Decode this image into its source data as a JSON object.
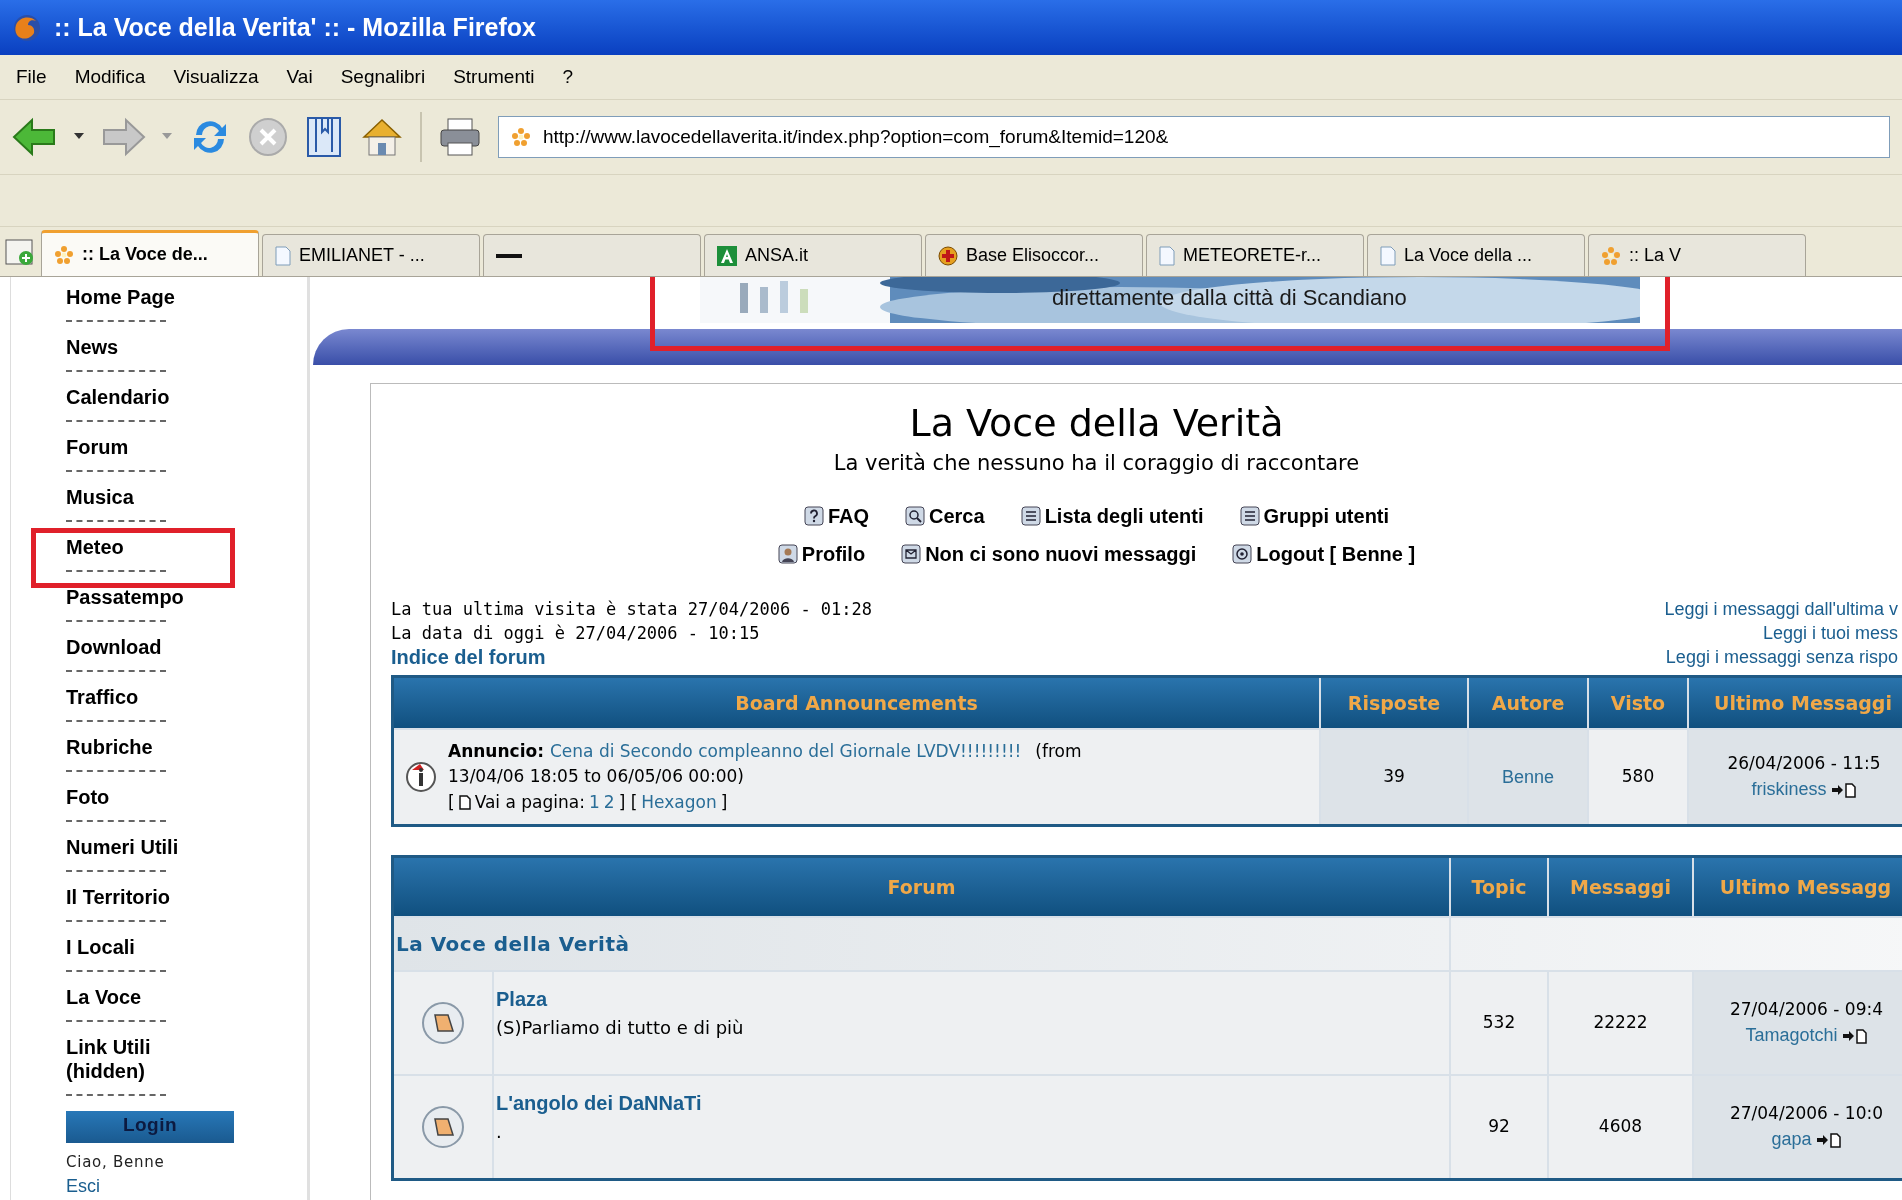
{
  "window": {
    "title": ":: La Voce della Verita' :: - Mozilla Firefox"
  },
  "menu": [
    "File",
    "Modifica",
    "Visualizza",
    "Vai",
    "Segnalibri",
    "Strumenti",
    "?"
  ],
  "address": {
    "url": "http://www.lavocedellaverita.it/index.php?option=com_forum&Itemid=120&"
  },
  "tabs": [
    {
      "label": ":: La Voce de...",
      "kind": "site",
      "selected": true
    },
    {
      "label": "EMILIANET - ...",
      "kind": "page",
      "selected": false
    },
    {
      "kind": "blank",
      "selected": false
    },
    {
      "label": "ANSA.it",
      "kind": "ansa",
      "selected": false
    },
    {
      "label": "Base Elisoccor...",
      "kind": "cross",
      "selected": false
    },
    {
      "label": "METEORETE-r...",
      "kind": "page",
      "selected": false
    },
    {
      "label": "La Voce della ...",
      "kind": "page",
      "selected": false
    },
    {
      "label": ":: La V",
      "kind": "site",
      "selected": false
    }
  ],
  "sidebar": {
    "items": [
      {
        "label": "Home Page",
        "highlighted": false
      },
      {
        "label": "News",
        "highlighted": false
      },
      {
        "label": "Calendario",
        "highlighted": false
      },
      {
        "label": "Forum",
        "highlighted": false
      },
      {
        "label": "Musica",
        "highlighted": false
      },
      {
        "label": "Meteo",
        "highlighted": true
      },
      {
        "label": "Passatempo",
        "highlighted": false
      },
      {
        "label": "Download",
        "highlighted": false
      },
      {
        "label": "Traffico",
        "highlighted": false
      },
      {
        "label": "Rubriche",
        "highlighted": false
      },
      {
        "label": "Foto",
        "highlighted": false
      },
      {
        "label": "Numeri Utili",
        "highlighted": false
      },
      {
        "label": "Il Territorio",
        "highlighted": false
      },
      {
        "label": "I Locali",
        "highlighted": false
      },
      {
        "label": "La Voce",
        "highlighted": false
      },
      {
        "label": "Link Utili (hidden)",
        "highlighted": false
      }
    ],
    "login": {
      "title": "Login",
      "greeting": "Ciao, Benne",
      "logout": "Esci"
    }
  },
  "banner": {
    "caption": "direttamente dalla città di Scandiano",
    "highlighted": true
  },
  "forum": {
    "title": "La Voce della Verità",
    "subtitle": "La verità che nessuno ha il coraggio di raccontare",
    "nav": [
      [
        {
          "label": "FAQ",
          "kind": "help"
        },
        {
          "label": "Cerca",
          "kind": "search"
        },
        {
          "label": "Lista degli utenti",
          "kind": "list"
        },
        {
          "label": "Gruppi utenti",
          "kind": "groups"
        }
      ],
      [
        {
          "label": "Profilo",
          "kind": "profile"
        },
        {
          "label": "Non ci sono nuovi messaggi",
          "kind": "messages"
        },
        {
          "label": "Logout [ Benne ]",
          "kind": "logout"
        }
      ]
    ],
    "info": [
      "La tua ultima visita è stata 27/04/2006 - 01:28",
      "La data di oggi è 27/04/2006 - 10:15"
    ],
    "breadcrumb": "Indice del forum",
    "right_links": [
      "Leggi i messaggi dall'ultima v",
      "Leggi i tuoi mess",
      "Leggi i messaggi senza rispo"
    ]
  },
  "announcements": {
    "columns": [
      "Board Announcements",
      "Risposte",
      "Autore",
      "Visto",
      "Ultimo Messaggi"
    ],
    "rows": [
      {
        "prefix": "Annuncio:",
        "title": "Cena di Secondo compleanno del Giornale LVDV!!!!!!!!!",
        "period_start": "(from",
        "period_end": "13/04/06 18:05 to 06/05/06 00:00)",
        "open_bracket": "[",
        "goto": "Vai a pagina:",
        "pages": [
          "1",
          "2"
        ],
        "mid_brackets": "] [",
        "extra": "Hexagon",
        "close_bracket": "]",
        "replies": "39",
        "author": "Benne",
        "views": "580",
        "last_date": "26/04/2006 - 11:5",
        "last_user": "friskiness"
      }
    ]
  },
  "forums": {
    "columns": [
      "Forum",
      "Topic",
      "Messaggi",
      "Ultimo Messagg"
    ],
    "category": "La Voce della Verità",
    "rows": [
      {
        "name": "Plaza",
        "description": "(S)Parliamo di tutto e di più",
        "topics": "532",
        "posts": "22222",
        "last_date": "27/04/2006 - 09:4",
        "last_user": "Tamagotchi"
      },
      {
        "name": "L'angolo dei DaNNaTi",
        "description": ".",
        "topics": "92",
        "posts": "4608",
        "last_date": "27/04/2006 - 10:0",
        "last_user": "gapa"
      }
    ]
  }
}
